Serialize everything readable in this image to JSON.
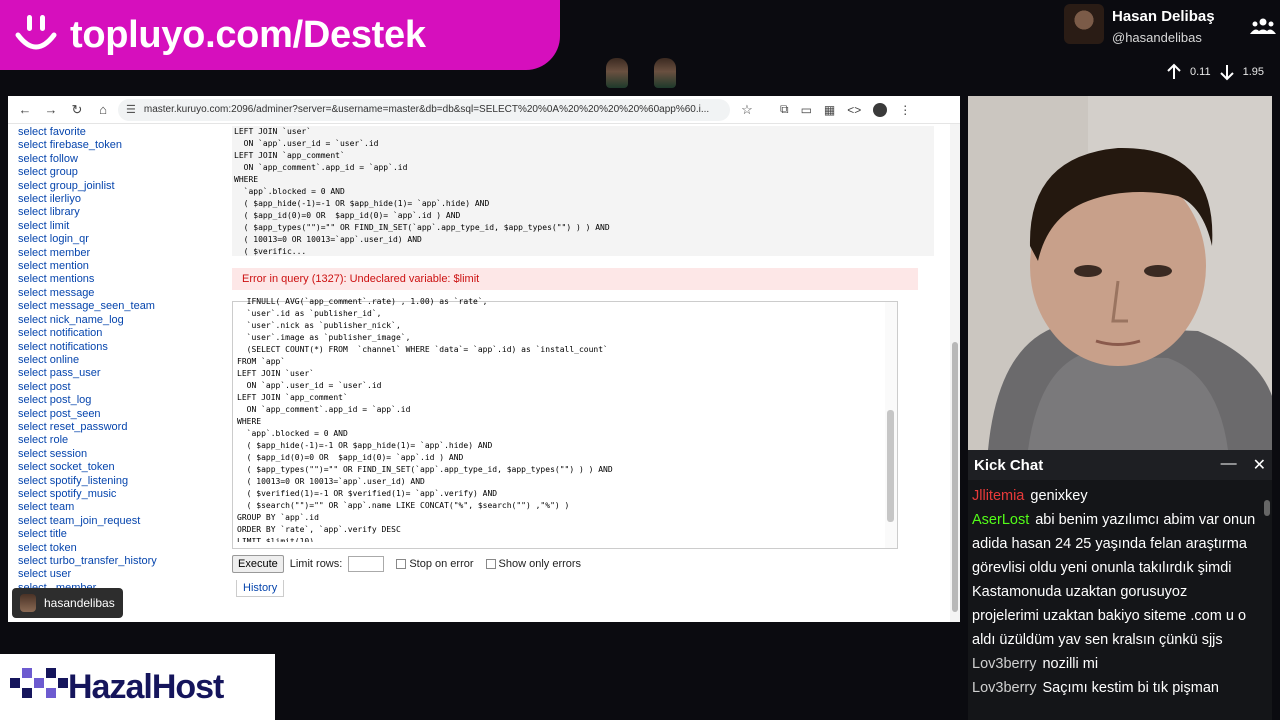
{
  "banner": {
    "text": "topluyo.com/Destek"
  },
  "streamer": {
    "name": "Hasan Delibaş",
    "handle": "@hasandelibas",
    "up_value": "0.11",
    "down_value": "1.95"
  },
  "browser": {
    "url": "master.kuruyo.com:2096/adminer?server=&username=master&db=db&sql=SELECT%20%0A%20%20%20%20%60app%60.i..."
  },
  "sidebar": {
    "items": [
      "select favorite",
      "select firebase_token",
      "select follow",
      "select group",
      "select group_joinlist",
      "select ilerliyo",
      "select library",
      "select limit",
      "select login_qr",
      "select member",
      "select mention",
      "select mentions",
      "select message",
      "select message_seen_team",
      "select nick_name_log",
      "select notification",
      "select notifications",
      "select online",
      "select pass_user",
      "select post",
      "select post_log",
      "select post_seen",
      "select reset_password",
      "select role",
      "select session",
      "select socket_token",
      "select spotify_listening",
      "select spotify_music",
      "select team",
      "select team_join_request",
      "select title",
      "select token",
      "select turbo_transfer_history",
      "select user",
      "select _member"
    ]
  },
  "query_preview": {
    "lines": [
      "LEFT JOIN `user`",
      "  ON `app`.user_id = `user`.id",
      "LEFT JOIN `app_comment`",
      "  ON `app_comment`.app_id = `app`.id",
      "WHERE",
      "  `app`.blocked = 0 AND",
      "  ( $app_hide(-1)=-1 OR $app_hide(1)= `app`.hide) AND",
      "  ( $app_id(0)=0 OR  $app_id(0)= `app`.id ) AND",
      "  ( $app_types(\"\")=\"\" OR FIND_IN_SET(`app`.app_type_id, $app_types(\"\") ) ) AND",
      "  ( 10013=0 OR 10013=`app`.user_id) AND",
      "  ( $verific..."
    ]
  },
  "error": {
    "text": "Error in query (1327): Undeclared variable: $limit"
  },
  "editor": {
    "lines": [
      "  IFNULL( AVG(`app_comment`.rate) , 1.00) as `rate`,",
      "  `user`.id as `publisher_id`,",
      "  `user`.nick as `publisher_nick`,",
      "  `user`.image as `publisher_image`,",
      "  (SELECT COUNT(*) FROM  `channel` WHERE `data`= `app`.id) as `install_count`",
      "FROM `app`",
      "LEFT JOIN `user`",
      "  ON `app`.user_id = `user`.id",
      "LEFT JOIN `app_comment`",
      "  ON `app_comment`.app_id = `app`.id",
      "WHERE",
      "  `app`.blocked = 0 AND",
      "  ( $app_hide(-1)=-1 OR $app_hide(1)= `app`.hide) AND",
      "  ( $app_id(0)=0 OR  $app_id(0)= `app`.id ) AND",
      "  ( $app_types(\"\")=\"\" OR FIND_IN_SET(`app`.app_type_id, $app_types(\"\") ) ) AND",
      "  ( 10013=0 OR 10013=`app`.user_id) AND",
      "  ( $verified(1)=-1 OR $verified(1)= `app`.verify) AND",
      "  ( $search(\"\")=\"\" OR `app`.name LIKE CONCAT(\"%\", $search(\"\") ,\"%\") )",
      "GROUP BY `app`.id",
      "ORDER BY `rate`, `app`.verify DESC",
      "LIMIT $limit(10)"
    ]
  },
  "controls": {
    "execute": "Execute",
    "limit_rows": "Limit rows:",
    "stop_on_error": "Stop on error",
    "show_only_errors": "Show only errors",
    "history": "History"
  },
  "viewer_tag": {
    "name": "hasandelibas"
  },
  "chat": {
    "title": "Kick Chat",
    "messages": [
      {
        "user": "Jllitemia",
        "user_color": "#e83a3a",
        "text": "genixkey"
      },
      {
        "user": "AserLost",
        "user_color": "#53fc18",
        "text": "abi benim yazılımcı abim var onun adida hasan 24 25 yaşında felan araştırma görevlisi oldu yeni onunla takılırdık şimdi Kastamonuda uzaktan gorusuyoz projelerimi uzaktan bakiyo siteme .com u o aldı üzüldüm yav sen kralsın çünkü sjjs"
      },
      {
        "user": "Lov3berry",
        "user_color": "#d0d0d0",
        "text": "nozilli mi"
      },
      {
        "user": "Lov3berry",
        "user_color": "#d0d0d0",
        "text": "Saçımı kestim bi tık pişman"
      }
    ]
  },
  "sponsor": {
    "name": "HazalHost"
  },
  "colors": {
    "banner": "#d60fbd",
    "kick_green": "#53fc18",
    "error_red": "#c11"
  }
}
